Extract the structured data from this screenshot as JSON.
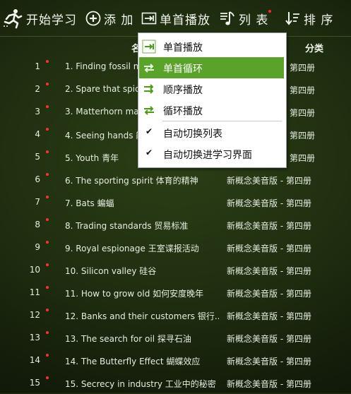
{
  "toolbar": {
    "study_label": "开始学习",
    "add_label": "添 加",
    "single_label": "单首播放",
    "list_label": "列 表",
    "sort_label": "排 序"
  },
  "header": {
    "name_col": "名",
    "category_col": "分类"
  },
  "rows": [
    {
      "num": "1",
      "title": "1. Finding fossil man",
      "category": "第四册"
    },
    {
      "num": "2",
      "title": "2. Spare that spider",
      "category": "第四册"
    },
    {
      "num": "3",
      "title": "3. Matterhorn man",
      "category": "第四册"
    },
    {
      "num": "4",
      "title": "4. Seeing hands 能",
      "category": "第四册"
    },
    {
      "num": "5",
      "title": "5. Youth 青年",
      "category": "第四册"
    },
    {
      "num": "6",
      "title": "6. The sporting spirit 体育的精神",
      "category": "新概念美音版 - 第四册"
    },
    {
      "num": "7",
      "title": "7. Bats 蝙蝠",
      "category": "新概念美音版 - 第四册"
    },
    {
      "num": "8",
      "title": "8. Trading standards 贸易标准",
      "category": "新概念美音版 - 第四册"
    },
    {
      "num": "9",
      "title": "9. Royal espionage 王室谍报活动",
      "category": "新概念美音版 - 第四册"
    },
    {
      "num": "10",
      "title": "10. Silicon valley 硅谷",
      "category": "新概念美音版 - 第四册"
    },
    {
      "num": "11",
      "title": "11. How to grow old 如何安度晚年",
      "category": "新概念美音版 - 第四册"
    },
    {
      "num": "12",
      "title": "12. Banks and their customers 银行...",
      "category": "新概念美音版 - 第四册"
    },
    {
      "num": "13",
      "title": "13. The search for oil 探寻石油",
      "category": "新概念美音版 - 第四册"
    },
    {
      "num": "14",
      "title": "14. The Butterfly Effect 蝴蝶效应",
      "category": "新概念美音版 - 第四册"
    },
    {
      "num": "15",
      "title": "15. Secrecy in industry 工业中的秘密",
      "category": "新概念美音版 - 第四册"
    }
  ],
  "menu": {
    "items": [
      {
        "label": "单首播放",
        "icon": "single-play-icon",
        "active": false
      },
      {
        "label": "单首循环",
        "icon": "single-loop-icon",
        "active": true
      },
      {
        "label": "顺序播放",
        "icon": "sequential-play-icon",
        "active": false
      },
      {
        "label": "循环播放",
        "icon": "loop-play-icon",
        "active": false
      }
    ],
    "options": [
      {
        "label": "自动切换列表",
        "checked": true
      },
      {
        "label": "自动切换进学习界面",
        "checked": true
      }
    ]
  },
  "colors": {
    "accent_green": "#5aa22a",
    "unread_dot": "#ff3030",
    "background": "#1f2e10"
  }
}
